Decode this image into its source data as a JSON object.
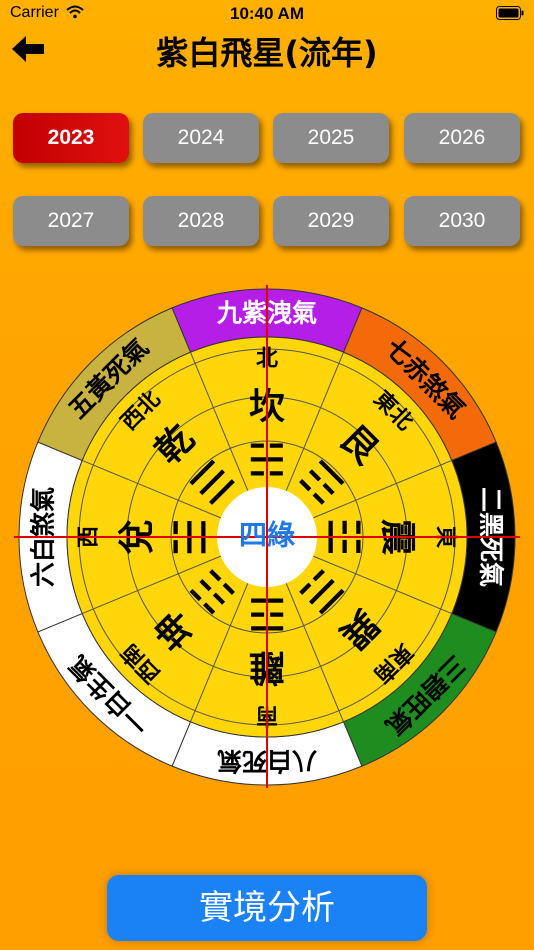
{
  "status": {
    "carrier": "Carrier",
    "time": "10:40 AM"
  },
  "header": {
    "title": "紫白飛星(流年)"
  },
  "years": [
    "2023",
    "2024",
    "2025",
    "2026",
    "2027",
    "2028",
    "2029",
    "2030"
  ],
  "selected_year": "2023",
  "center": "四綠",
  "outer_ring": [
    {
      "text": "九紫洩氣",
      "color": "#b41ee6",
      "text_color": "#ffffff"
    },
    {
      "text": "七赤煞氣",
      "color": "#f26a0a",
      "text_color": "#000000"
    },
    {
      "text": "二黑死氣",
      "color": "#000000",
      "text_color": "#ffffff"
    },
    {
      "text": "三碧旺氣",
      "color": "#1f8c1f",
      "text_color": "#000000"
    },
    {
      "text": "八白死氣",
      "color": "#ffffff",
      "text_color": "#000000"
    },
    {
      "text": "一白生氣",
      "color": "#ffffff",
      "text_color": "#000000"
    },
    {
      "text": "六白煞氣",
      "color": "#ffffff",
      "text_color": "#000000"
    },
    {
      "text": "五黃死氣",
      "color": "#c8b240",
      "text_color": "#000000"
    }
  ],
  "directions": [
    "北",
    "東北",
    "東",
    "東南",
    "南",
    "西南",
    "西",
    "西北"
  ],
  "trigrams": [
    "坎",
    "艮",
    "震",
    "巽",
    "離",
    "坤",
    "兌",
    "乾"
  ],
  "trigram_symbols": [
    "☵",
    "☶",
    "☳",
    "☴",
    "☲",
    "☷",
    "☱",
    "☰"
  ],
  "footer": {
    "button_label": "實境分析"
  }
}
